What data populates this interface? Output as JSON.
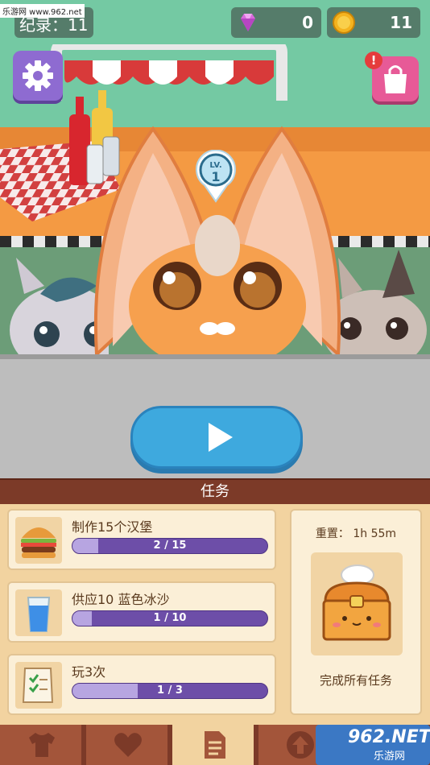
{
  "hud": {
    "record_label": "纪录：11",
    "gems": "0",
    "coins": "11",
    "level_lv": "LV.",
    "level_num": "1",
    "shop_alert": "!"
  },
  "tasks": {
    "header": "任务",
    "items": [
      {
        "title": "制作15个汉堡",
        "progress_text": "2 / 15",
        "progress": 0.133,
        "icon": "burger-icon"
      },
      {
        "title": "供应10 蓝色冰沙",
        "progress_text": "1 / 10",
        "progress": 0.1,
        "icon": "smoothie-icon"
      },
      {
        "title": "玩3次",
        "progress_text": "1 / 3",
        "progress": 0.333,
        "icon": "checklist-icon"
      }
    ],
    "reset_label": "重置： 1h 55m",
    "complete_all": "完成所有任务"
  },
  "nav": {
    "items": [
      "shirt-icon",
      "heart-icon",
      "tasks-icon",
      "upgrade-icon"
    ],
    "active": 2
  },
  "watermark": {
    "top": "乐游网 www.962.net",
    "brand": "962.NET",
    "brand_sub": "乐游网"
  },
  "colors": {
    "accent_purple": "#6d4ea8",
    "play_blue": "#3ea9de",
    "tasks_header": "#7c3a28"
  }
}
